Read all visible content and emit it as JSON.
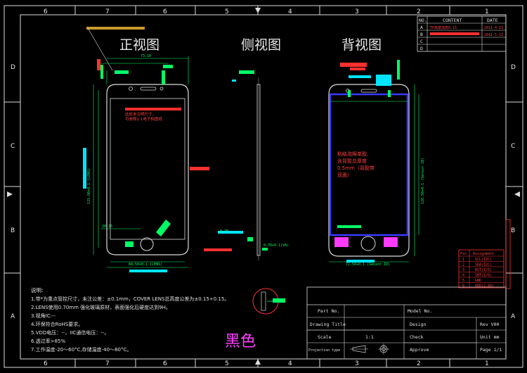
{
  "zones": {
    "top": [
      "6",
      "7",
      "6",
      "5",
      "4",
      "3",
      "2",
      "1"
    ],
    "bottom": [
      "6",
      "7",
      "6",
      "5",
      "4",
      "3",
      "2",
      "1"
    ],
    "left": [
      "D",
      "C",
      "B",
      "A"
    ],
    "right": [
      "D",
      "C",
      "B",
      "A"
    ]
  },
  "view_titles": {
    "front": "正视图",
    "side": "侧视图",
    "back": "背视图"
  },
  "revision_table": {
    "headers": [
      "NO.",
      "CONTENT",
      "DATE"
    ],
    "rows": [
      {
        "no": "A",
        "content": "TP高度加高0.15",
        "date": "2011-4-15"
      },
      {
        "no": "B",
        "content": "",
        "date": "2011-5-12"
      },
      {
        "no": "C",
        "content": "",
        "date": ""
      },
      {
        "no": "D",
        "content": "",
        "date": ""
      }
    ]
  },
  "notes": {
    "heading": "说明:",
    "lines": [
      "1.带*为重点管控尺寸，未注公差：±0.1mm，COVER LENS总高度公差为±0.15+0.15。",
      "2.LENS使用0.70mm 强化玻璃原材，表面强化后硬度达到9H。",
      "3.视角IC:--",
      "4.环保符合RoHS要求。",
      "5.VDD电压：--，IIC通信电压：--。",
      "6.透过率>85%",
      "7.工作温度-20～60°C,存储温度-40～80°C。"
    ]
  },
  "back_annotation": [
    "粘结泡棉单胶,",
    "含背胶总厚度",
    "0.5mm（背胶带",
    "双面）"
  ],
  "front_annotation": [
    "此处未注明尺寸，",
    "可参照1:1电子档图纸"
  ],
  "color_label": "黑色",
  "title_block": {
    "part_no": "Part No.",
    "drawing_title": "Drawing Title",
    "scale_label": "Scale",
    "scale_value": "1:1",
    "projection": "Projection type",
    "model_no": "Model No.",
    "design": "Design",
    "check": "Check",
    "approve": "Approve",
    "rev": "Rev V00",
    "unit": "Unit mm",
    "page": "Page 1/1"
  },
  "pin_table": {
    "headers": [
      "Pin",
      "Assignment"
    ],
    "rows": [
      {
        "pin": "1",
        "assign": "SCL(I2C)"
      },
      {
        "pin": "2",
        "assign": "SDA(I2C)"
      },
      {
        "pin": "3",
        "assign": "RST(I/O)"
      },
      {
        "pin": "4",
        "assign": "INT(I/O)"
      },
      {
        "pin": "5",
        "assign": "GND"
      },
      {
        "pin": "6",
        "assign": "VDD(2.8V)"
      }
    ]
  },
  "dims": {
    "front_w": "73.10",
    "front_h": "131.80+0.1 (LENS)",
    "front_bottom": "68.50+0.1 (LENS)",
    "back_w": "72.50+0.1 (Sensor ID)",
    "back_h": "128.50+0.1 (Sensor ID)",
    "side_t": "0.70",
    "front_small": "20.15",
    "side_h": "0.70+0.1(VA)"
  }
}
